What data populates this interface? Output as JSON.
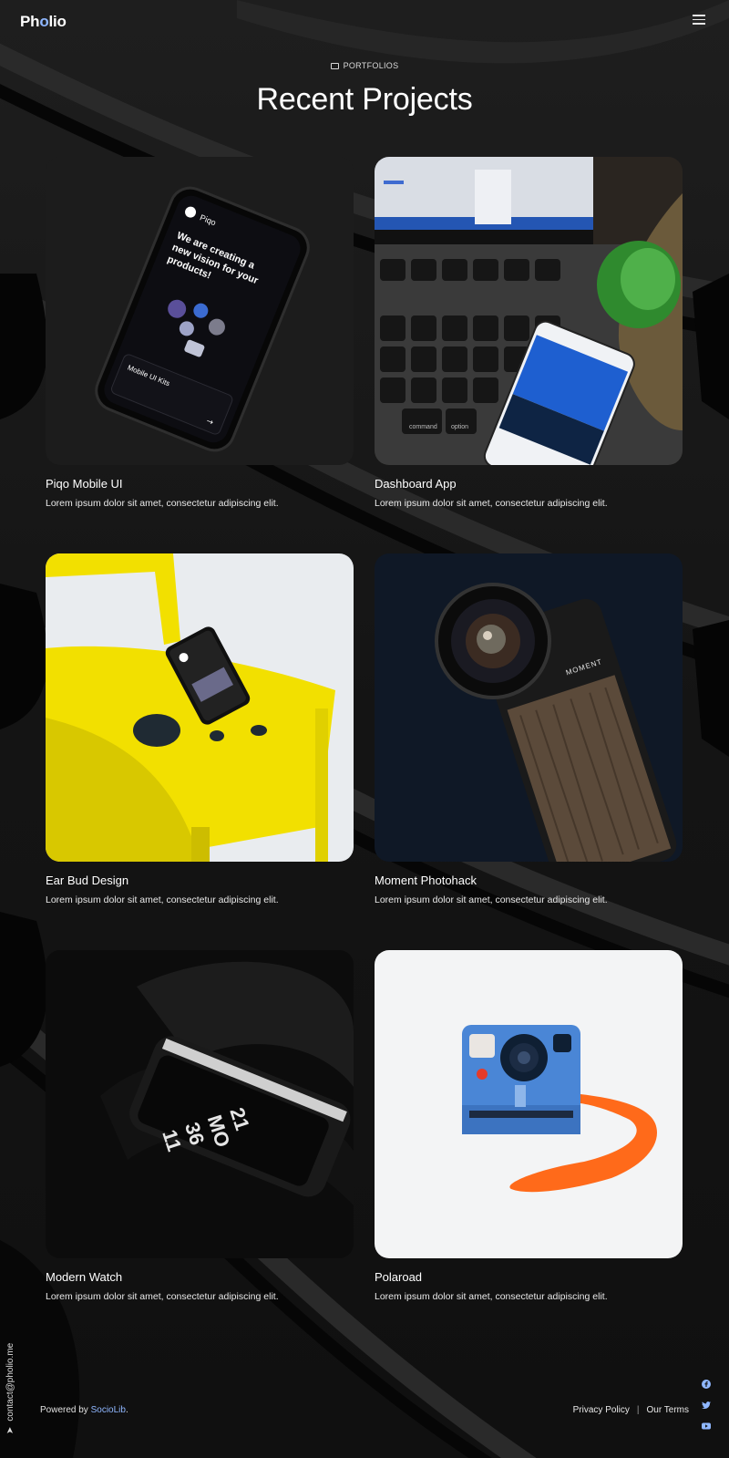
{
  "brand": {
    "logo_prefix": "Ph",
    "logo_accent": "o",
    "logo_suffix": "lio"
  },
  "header": {
    "menu_icon": "hamburger-menu-icon"
  },
  "section": {
    "tag": "PORTFOLIOS",
    "tag_icon": "folder-icon",
    "title": "Recent Projects"
  },
  "projects": [
    {
      "title": "Piqo Mobile UI",
      "description": "Lorem ipsum dolor sit amet, consectetur adipiscing elit.",
      "phone_heading_1": "We are creating a",
      "phone_heading_2": "new vision for your",
      "phone_heading_3": "products!",
      "phone_app": "Piqo",
      "phone_bottom": "Mobile UI Kits"
    },
    {
      "title": "Dashboard App",
      "description": "Lorem ipsum dolor sit amet, consectetur adipiscing elit.",
      "key_command": "command",
      "key_option": "option"
    },
    {
      "title": "Ear Bud Design",
      "description": "Lorem ipsum dolor sit amet, consectetur adipiscing elit."
    },
    {
      "title": "Moment Photohack",
      "description": "Lorem ipsum dolor sit amet, consectetur adipiscing elit.",
      "brand_mark": "MOMENT"
    },
    {
      "title": "Modern Watch",
      "description": "Lorem ipsum dolor sit amet, consectetur adipiscing elit.",
      "watch_digits": [
        "11",
        "36",
        "MO",
        "21"
      ]
    },
    {
      "title": "Polaroad",
      "description": "Lorem ipsum dolor sit amet, consectetur adipiscing elit."
    }
  ],
  "footer": {
    "contact": "contact@pholio.me",
    "powered_prefix": "Powered by ",
    "powered_link": "SocioLib",
    "powered_suffix": ".",
    "privacy": "Privacy Policy",
    "separator": "|",
    "terms": "Our Terms",
    "social_icons": [
      "facebook-icon",
      "twitter-icon",
      "youtube-icon"
    ]
  },
  "colors": {
    "accent": "#8fb7ff",
    "background": "#151515",
    "yellow": "#f2e000",
    "orange": "#ff6a1a",
    "blue": "#4a86d6"
  }
}
